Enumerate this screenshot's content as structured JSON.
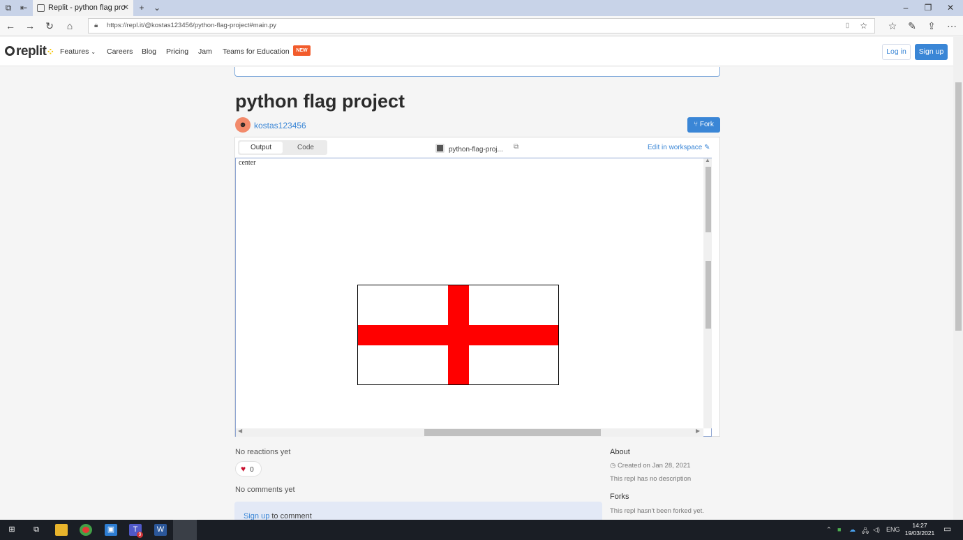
{
  "browser": {
    "tab_title": "Replit - python flag pro",
    "url": "https://repl.it/@kostas123456/python-flag-project#main.py"
  },
  "header": {
    "logo": "replit",
    "nav": [
      {
        "label": "Features"
      },
      {
        "label": "Careers"
      },
      {
        "label": "Blog"
      },
      {
        "label": "Pricing"
      },
      {
        "label": "Jam"
      },
      {
        "label": "Teams for Education"
      }
    ],
    "new_badge": "NEW",
    "login_label": "Log in",
    "signup_label": "Sign up"
  },
  "repl": {
    "title": "python flag project",
    "author": "kostas123456",
    "fork_label": "Fork",
    "tabs": [
      "Output",
      "Code"
    ],
    "repl_name": "python-flag-proj...",
    "edit_label": "Edit in workspace",
    "output_text": "center"
  },
  "flag": {
    "background": "#ffffff",
    "cross_color": "#ff0000",
    "border_color": "#000000"
  },
  "engagement": {
    "reactions_text": "No reactions yet",
    "heart_count": "0",
    "comments_text": "No comments yet",
    "signup_link": "Sign up",
    "comment_suffix": "to comment"
  },
  "sidebar": {
    "about_heading": "About",
    "created": "Created on Jan 28, 2021",
    "description": "This repl has no description",
    "forks_heading": "Forks",
    "forks_text": "This repl hasn't been forked yet."
  },
  "taskbar": {
    "language": "ENG",
    "time": "14:27",
    "date": "19/03/2021",
    "teams_badge": "9"
  },
  "colors": {
    "accent": "#3a86d6",
    "badge": "#f25c2c",
    "taskbar": "#1a1e25"
  }
}
